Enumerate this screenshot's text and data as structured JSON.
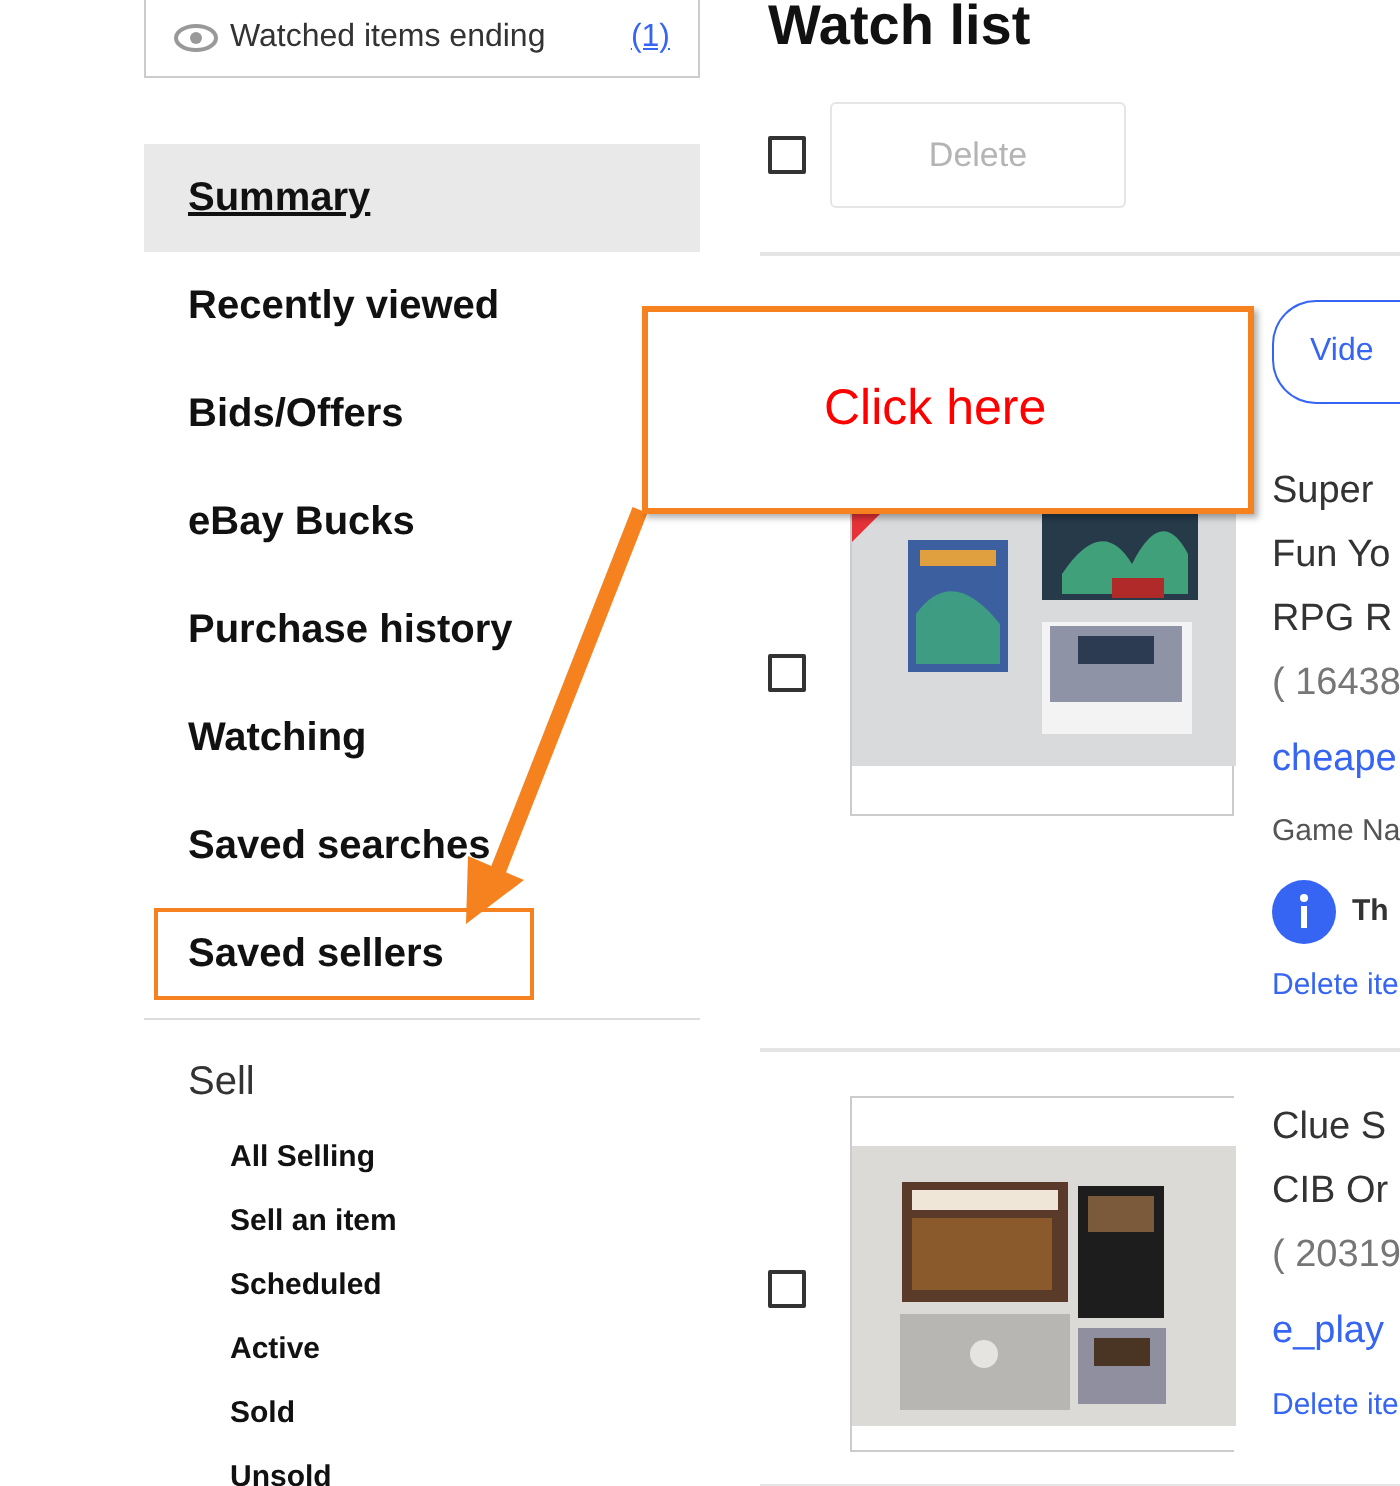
{
  "summary_box": {
    "label": "Watched items ending",
    "count": "(1)"
  },
  "nav": [
    {
      "label": "Summary",
      "selected": true,
      "highlighted": false
    },
    {
      "label": "Recently viewed",
      "selected": false,
      "highlighted": false
    },
    {
      "label": "Bids/Offers",
      "selected": false,
      "highlighted": false
    },
    {
      "label": "eBay Bucks",
      "selected": false,
      "highlighted": false
    },
    {
      "label": "Purchase history",
      "selected": false,
      "highlighted": false
    },
    {
      "label": "Watching",
      "selected": false,
      "highlighted": false
    },
    {
      "label": "Saved searches",
      "selected": false,
      "highlighted": false
    },
    {
      "label": "Saved sellers",
      "selected": false,
      "highlighted": true
    }
  ],
  "sell": {
    "heading": "Sell",
    "items": [
      "All Selling",
      "Sell an item",
      "Scheduled",
      "Active",
      "Sold",
      "Unsold"
    ]
  },
  "title": "Watch list",
  "toolbar": {
    "checked": false,
    "delete_label": "Delete",
    "delete_disabled": true
  },
  "items": [
    {
      "checked": false,
      "ribbon": true,
      "button": "Vide",
      "title_lines": [
        "Super",
        "Fun Yo",
        "RPG R"
      ],
      "number": "( 16438",
      "seller": "cheape",
      "detail": "Game Na",
      "notice": "Th",
      "action": "Delete ite"
    },
    {
      "checked": false,
      "ribbon": false,
      "title_lines": [
        "Clue S",
        "CIB Or"
      ],
      "number": "( 20319",
      "seller": "e_play",
      "action": "Delete ite"
    }
  ],
  "callout": {
    "text": "Click here"
  }
}
